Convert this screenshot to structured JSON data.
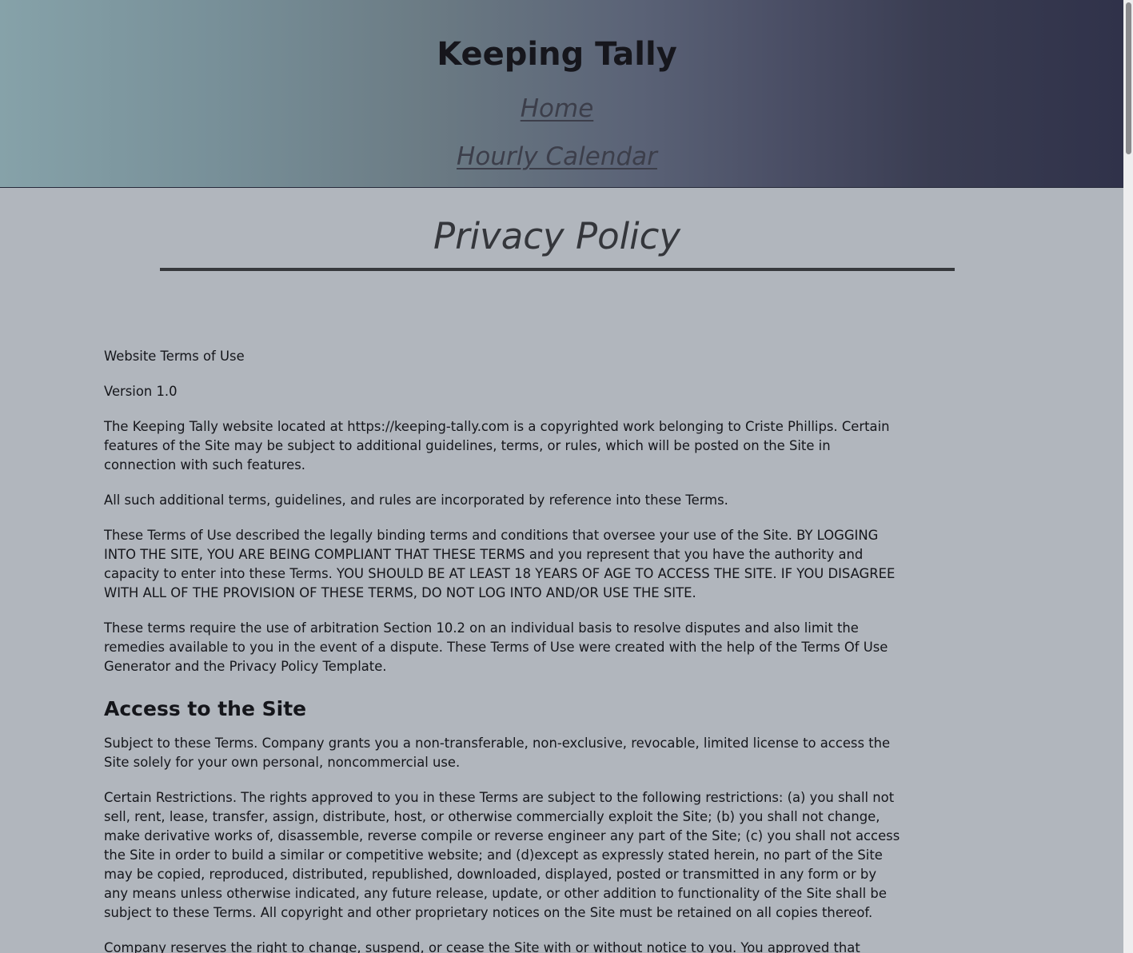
{
  "header": {
    "site_title": "Keeping Tally",
    "nav": {
      "home": "Home",
      "hourly_calendar": "Hourly Calendar"
    }
  },
  "main": {
    "page_heading": "Privacy Policy",
    "paragraphs_intro": [
      "Website Terms of Use",
      "Version 1.0",
      "The Keeping Tally website located at https://keeping-tally.com is a copyrighted work belonging to Criste Phillips. Certain features of the Site may be subject to additional guidelines, terms, or rules, which will be posted on the Site in connection with such features.",
      "All such additional terms, guidelines, and rules are incorporated by reference into these Terms.",
      "These Terms of Use described the legally binding terms and conditions that oversee your use of the Site. BY LOGGING INTO THE SITE, YOU ARE BEING COMPLIANT THAT THESE TERMS and you represent that you have the authority and capacity to enter into these Terms. YOU SHOULD BE AT LEAST 18 YEARS OF AGE TO ACCESS THE SITE. IF YOU DISAGREE WITH ALL OF THE PROVISION OF THESE TERMS, DO NOT LOG INTO AND/OR USE THE SITE.",
      "These terms require the use of arbitration Section 10.2 on an individual basis to resolve disputes and also limit the remedies available to you in the event of a dispute. These Terms of Use were created with the help of the Terms Of Use Generator and the Privacy Policy Template."
    ],
    "section_access": {
      "heading": "Access to the Site",
      "paragraphs": [
        "Subject to these Terms. Company grants you a non-transferable, non-exclusive, revocable, limited license to access the Site solely for your own personal, noncommercial use.",
        "Certain Restrictions. The rights approved to you in these Terms are subject to the following restrictions: (a) you shall not sell, rent, lease, transfer, assign, distribute, host, or otherwise commercially exploit the Site; (b) you shall not change, make derivative works of, disassemble, reverse compile or reverse engineer any part of the Site; (c) you shall not access the Site in order to build a similar or competitive website; and (d)except as expressly stated herein, no part of the Site may be copied, reproduced, distributed, republished, downloaded, displayed, posted or transmitted in any form or by any means unless otherwise indicated, any future release, update, or other addition to functionality of the Site shall be subject to these Terms. All copyright and other proprietary notices on the Site must be retained on all copies thereof.",
        "Company reserves the right to change, suspend, or cease the Site with or without notice to you. You approved that"
      ]
    }
  }
}
